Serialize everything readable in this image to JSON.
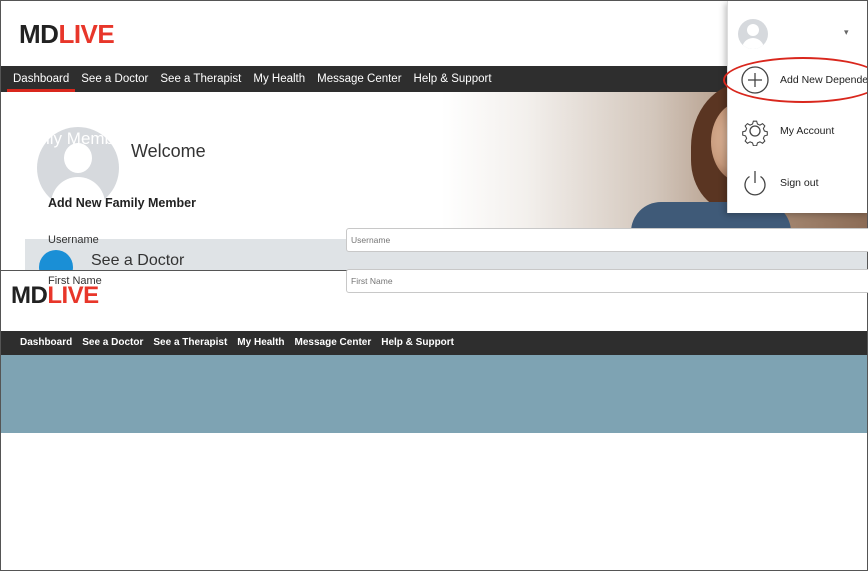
{
  "brand": {
    "md": "MD",
    "live": "LIVE",
    "accent_color": "#e8362a"
  },
  "panel1": {
    "nav": {
      "items": [
        {
          "label": "Dashboard",
          "active": true
        },
        {
          "label": "See a Doctor"
        },
        {
          "label": "See a Therapist"
        },
        {
          "label": "My Health"
        },
        {
          "label": "Message Center"
        },
        {
          "label": "Help & Support"
        }
      ]
    },
    "welcome": "Welcome",
    "see_doctor": "See a Doctor",
    "user_menu": {
      "caret": "▾",
      "items": [
        {
          "label": "Add New Dependen",
          "icon": "plus-circle-icon"
        },
        {
          "label": "My Account",
          "icon": "gear-icon"
        },
        {
          "label": "Sign out",
          "icon": "power-icon"
        }
      ]
    }
  },
  "panel2": {
    "nav": {
      "items": [
        {
          "label": "Dashboard"
        },
        {
          "label": "See a Doctor"
        },
        {
          "label": "See a Therapist"
        },
        {
          "label": "My Health"
        },
        {
          "label": "Message Center"
        },
        {
          "label": "Help & Support"
        }
      ]
    },
    "banner_title": "Family Members",
    "form": {
      "title": "Add New Family Member",
      "fields": [
        {
          "label": "Username",
          "placeholder": "Username",
          "value": ""
        },
        {
          "label": "First Name",
          "placeholder": "First Name",
          "value": ""
        }
      ]
    }
  }
}
